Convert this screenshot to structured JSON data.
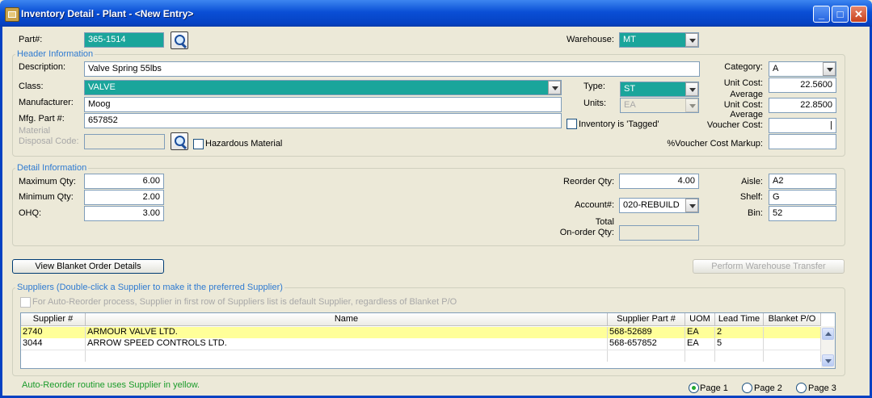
{
  "window": {
    "title": "Inventory Detail - Plant - <New Entry>",
    "minimize": "_",
    "maximize": "□",
    "close": "✕"
  },
  "top": {
    "part_label": "Part#:",
    "part_value": "365-1514",
    "warehouse_label": "Warehouse:",
    "warehouse_value": "MT"
  },
  "header": {
    "group_title": "Header Information",
    "description_label": "Description:",
    "description_value": "Valve Spring 55lbs",
    "class_label": "Class:",
    "class_value": "VALVE",
    "manufacturer_label": "Manufacturer:",
    "manufacturer_value": "Moog",
    "mfg_part_label": "Mfg. Part #:",
    "mfg_part_value": "657852",
    "disposal_label_1": "Material",
    "disposal_label_2": "Disposal Code:",
    "disposal_value": "",
    "hazardous_label": "Hazardous Material",
    "type_label": "Type:",
    "type_value": "ST",
    "units_label": "Units:",
    "units_value": "EA",
    "tagged_label": "Inventory is 'Tagged'",
    "category_label": "Category:",
    "category_value": "A",
    "unit_cost_label": "Unit Cost:",
    "unit_cost_value": "22.5600",
    "avg_unit_cost_label_1": "Average",
    "avg_unit_cost_label_2": "Unit Cost:",
    "avg_unit_cost_value": "22.8500",
    "avg_voucher_label_1": "Average",
    "avg_voucher_label_2": "Voucher Cost:",
    "avg_voucher_value": "|",
    "voucher_markup_label": "%Voucher Cost Markup:",
    "voucher_markup_value": ""
  },
  "detail": {
    "group_title": "Detail Information",
    "max_qty_label": "Maximum Qty:",
    "max_qty_value": "6.00",
    "min_qty_label": "Minimum Qty:",
    "min_qty_value": "2.00",
    "ohq_label": "OHQ:",
    "ohq_value": "3.00",
    "reorder_label": "Reorder Qty:",
    "reorder_value": "4.00",
    "account_label": "Account#:",
    "account_value": "020-REBUILD",
    "onorder_label_1": "Total",
    "onorder_label_2": "On-order Qty:",
    "onorder_value": "",
    "aisle_label": "Aisle:",
    "aisle_value": "A2",
    "shelf_label": "Shelf:",
    "shelf_value": "G",
    "bin_label": "Bin:",
    "bin_value": "52"
  },
  "buttons": {
    "blanket": "View Blanket Order Details",
    "transfer": "Perform Warehouse Transfer"
  },
  "suppliers": {
    "group_title": "Suppliers  (Double-click a Supplier to make it the preferred Supplier)",
    "auto_reorder_note": "For Auto-Reorder process, Supplier in first row of Suppliers list is default Supplier, regardless of Blanket P/O",
    "columns": [
      "Supplier #",
      "Name",
      "Supplier Part #",
      "UOM",
      "Lead Time",
      "Blanket P/O"
    ],
    "rows": [
      [
        "2740",
        "ARMOUR VALVE LTD.",
        "568-52689",
        "EA",
        "2",
        ""
      ],
      [
        "3044",
        "ARROW SPEED CONTROLS LTD.",
        "568-657852",
        "EA",
        "5",
        ""
      ]
    ],
    "highlight_color": "#ffff99"
  },
  "footer": {
    "note": "Auto-Reorder routine uses Supplier in yellow.",
    "pages": [
      "Page 1",
      "Page 2",
      "Page 3"
    ],
    "selected_page": "Page 1"
  }
}
